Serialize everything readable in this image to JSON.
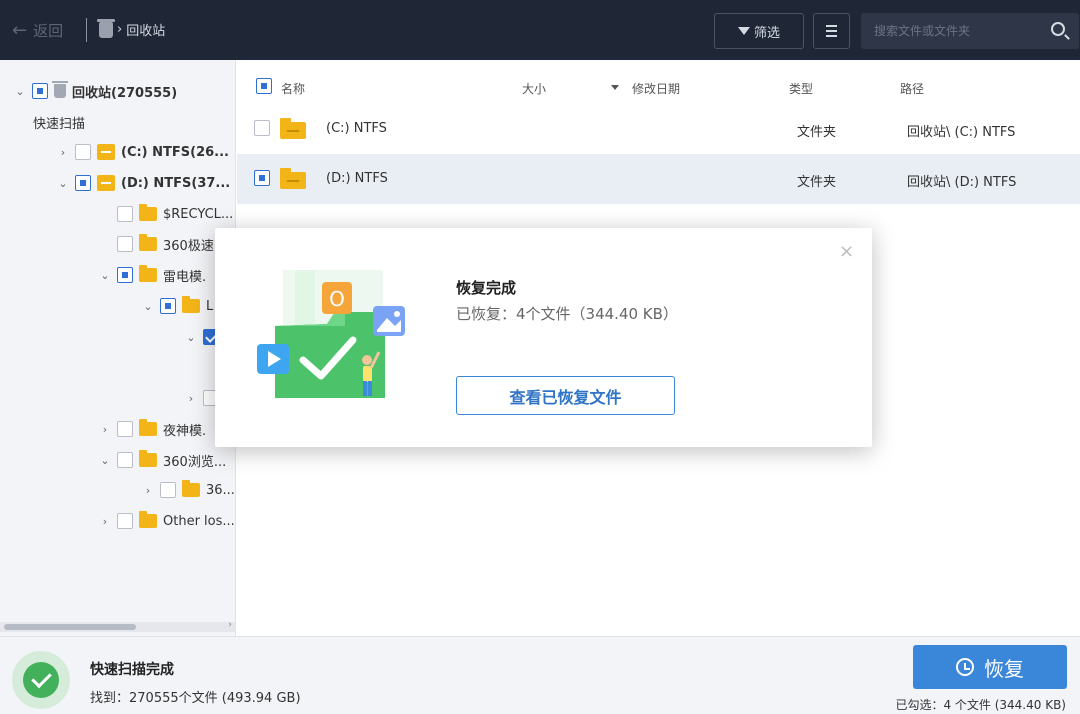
{
  "topbar": {
    "back_label": "返回",
    "breadcrumb": "回收站",
    "filter_label": "筛选",
    "search_placeholder": "搜索文件或文件夹"
  },
  "tree": {
    "root": "回收站(270555)",
    "section": "快速扫描",
    "items": [
      {
        "label": "(C:) NTFS(26..."
      },
      {
        "label": "(D:) NTFS(37..."
      },
      {
        "label": "$RECYCL..."
      },
      {
        "label": "360极速"
      },
      {
        "label": "雷电模."
      },
      {
        "label": "L"
      },
      {
        "label": "夜神模."
      },
      {
        "label": "360浏览..."
      },
      {
        "label": "36..."
      },
      {
        "label": "Other los..."
      }
    ]
  },
  "table": {
    "headers": {
      "name": "名称",
      "size": "大小",
      "modified": "修改日期",
      "type": "类型",
      "path": "路径"
    },
    "rows": [
      {
        "name": "(C:) NTFS",
        "type": "文件夹",
        "path": "回收站\\ (C:) NTFS",
        "selected": false
      },
      {
        "name": "(D:) NTFS",
        "type": "文件夹",
        "path": "回收站\\ (D:) NTFS",
        "selected": true
      }
    ]
  },
  "dialog": {
    "title": "恢复完成",
    "subtitle": "已恢复：4个文件（344.40 KB）",
    "button": "查看已恢复文件"
  },
  "status": {
    "title": "快速扫描完成",
    "found": "找到：270555个文件 (493.94 GB)",
    "recover_label": "恢复",
    "selected": "已勾选：4 个文件 (344.40 KB)"
  },
  "colors": {
    "topbar": "#1f2636",
    "accent": "#3a86d8",
    "folder": "#f2b417",
    "success": "#43b05c"
  }
}
